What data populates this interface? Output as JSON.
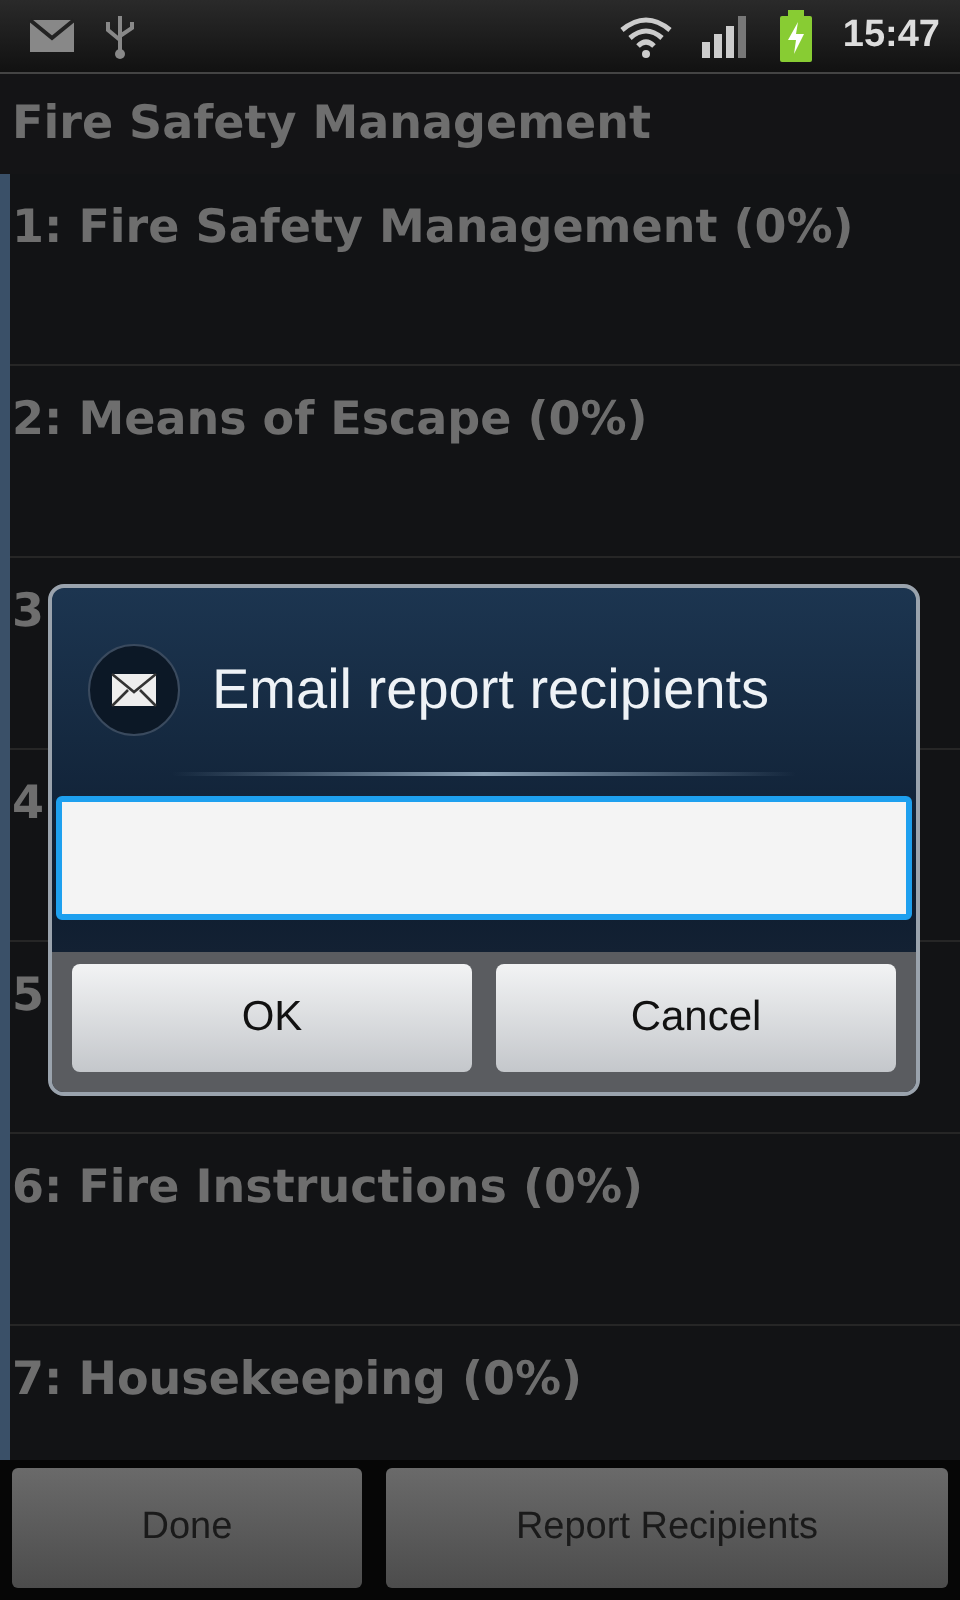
{
  "status_bar": {
    "time": "15:47"
  },
  "title": "Fire Safety Management",
  "sections": [
    {
      "label": "1: Fire Safety Management (0%)"
    },
    {
      "label": "2: Means of Escape (0%)"
    },
    {
      "label": "3"
    },
    {
      "label": "4"
    },
    {
      "label": "5"
    },
    {
      "label": "6: Fire Instructions (0%)"
    },
    {
      "label": "7: Housekeeping (0%)"
    }
  ],
  "dialog": {
    "title": "Email report recipients",
    "buttons": [
      "OK",
      "Cancel"
    ]
  },
  "bottom_buttons": [
    "Done",
    "Report Recipients"
  ]
}
